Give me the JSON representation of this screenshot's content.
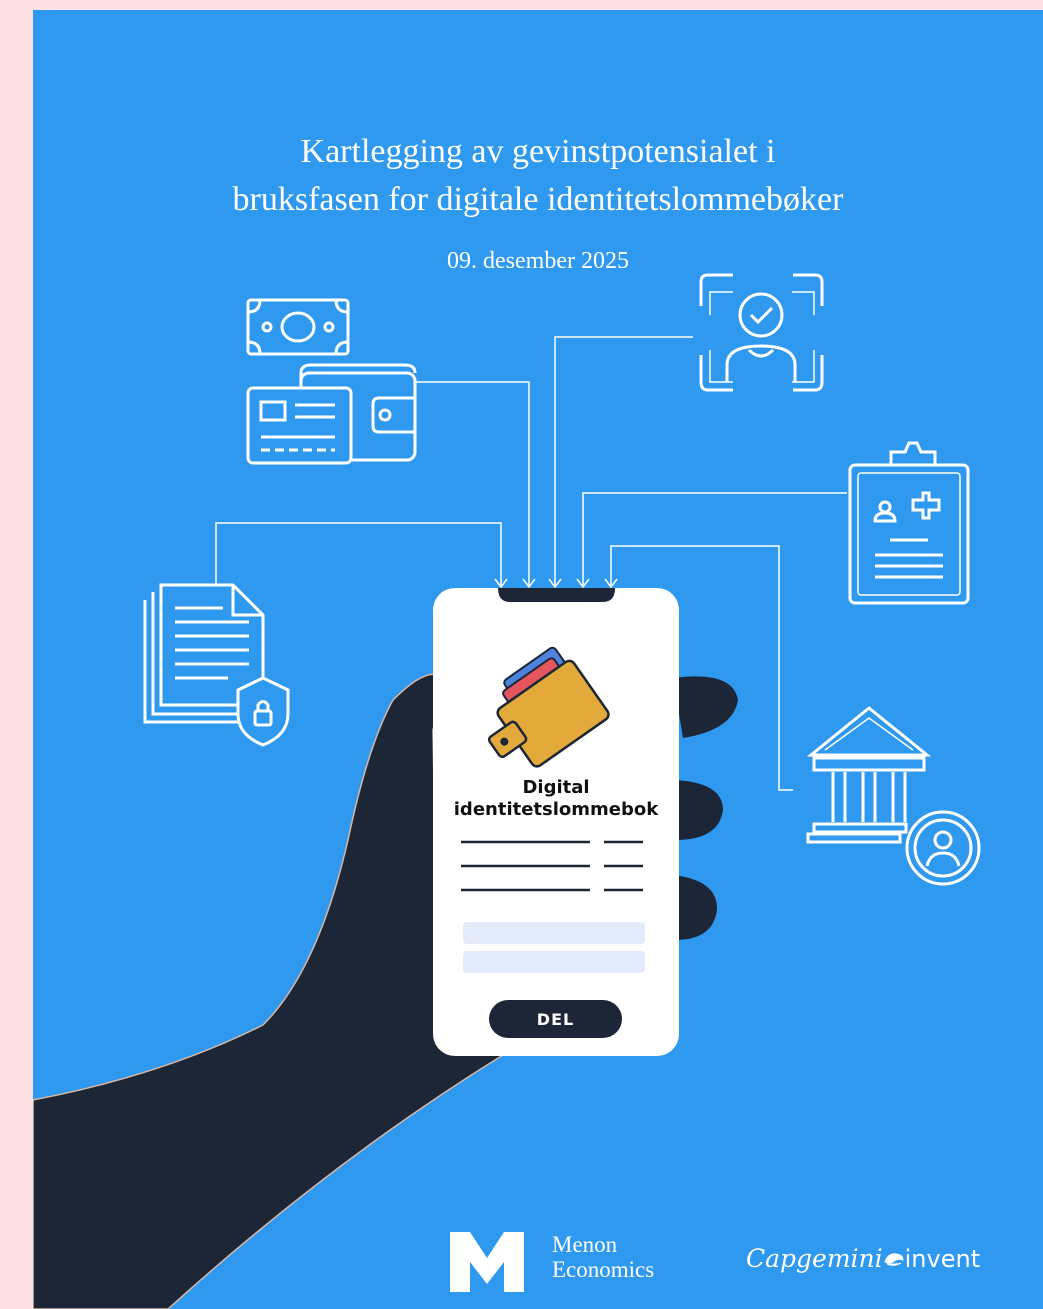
{
  "report": {
    "title_line_1": "Kartlegging av gevinstpotensialet i",
    "title_line_2": "bruksfasen for digitale identitetslommebøker",
    "date": "09. desember 2025"
  },
  "phone": {
    "wallet_title_line_1": "Digital",
    "wallet_title_line_2": "identitetslommebok",
    "share_button_label": "DEL"
  },
  "logos": {
    "menon_line_1": "Menon",
    "menon_line_2": "Economics",
    "capgemini_word": "Capgemini",
    "invent_word": "invent"
  },
  "icons": [
    "money-wallet-icon",
    "face-verification-icon",
    "medical-clipboard-icon",
    "secure-documents-icon",
    "government-building-icon",
    "wallet-icon"
  ],
  "colors": {
    "background": "#2f98ef",
    "page_margin": "#fbe1e3",
    "hand": "#1c2637",
    "wallet": "#e3a93a",
    "card_red": "#e4555c",
    "card_blue": "#4d82df"
  }
}
